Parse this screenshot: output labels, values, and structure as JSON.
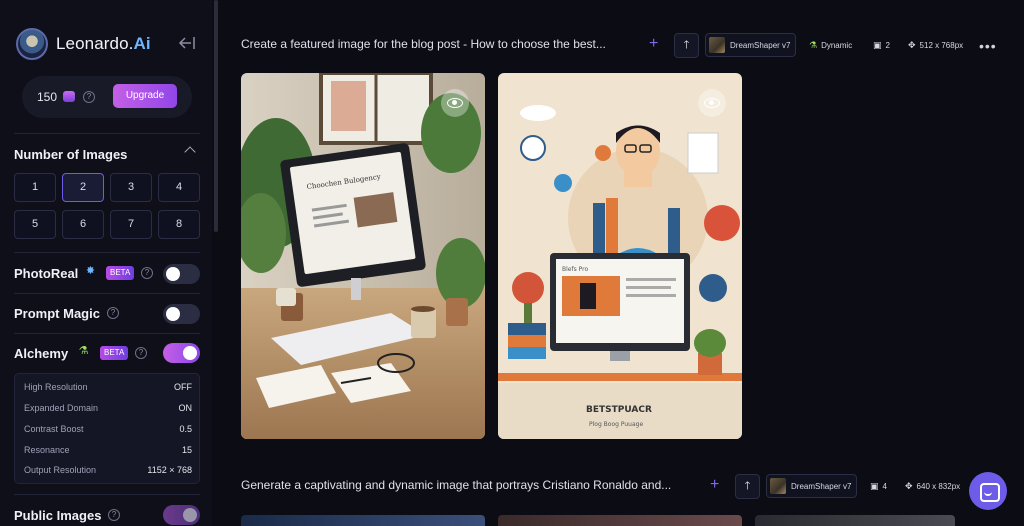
{
  "brand": {
    "name_prefix": "Leonardo.",
    "name_suffix": "Ai"
  },
  "tokens": {
    "count": "150",
    "help": "?",
    "upgrade_label": "Upgrade"
  },
  "number_of_images": {
    "title": "Number of Images",
    "options": [
      "1",
      "2",
      "3",
      "4",
      "5",
      "6",
      "7",
      "8"
    ],
    "selected": "2"
  },
  "photoreal": {
    "label": "PhotoReal",
    "badge": "BETA",
    "enabled": false
  },
  "prompt_magic": {
    "label": "Prompt Magic",
    "enabled": false
  },
  "alchemy": {
    "label": "Alchemy",
    "badge": "BETA",
    "enabled": true,
    "settings": [
      {
        "label": "High Resolution",
        "value": "OFF"
      },
      {
        "label": "Expanded Domain",
        "value": "ON"
      },
      {
        "label": "Contrast Boost",
        "value": "0.5"
      },
      {
        "label": "Resonance",
        "value": "15"
      },
      {
        "label": "Output Resolution",
        "value": "1152 × 768"
      }
    ]
  },
  "public_images": {
    "label": "Public Images",
    "enabled": true
  },
  "generations": [
    {
      "prompt": "Create a featured image for the blog post - How to choose the best...",
      "model": "DreamShaper v7",
      "style": "Dynamic",
      "count": "2",
      "size": "512 x 768px",
      "images": [
        {
          "screen_title": "Choochen Bulogency"
        },
        {
          "caption_title": "BETSTPUACR",
          "caption_sub": "Plog Boog Puuage",
          "screen_label": "Blefs Pro"
        }
      ]
    },
    {
      "prompt": "Generate a captivating and dynamic image that portrays Cristiano Ronaldo and...",
      "model": "DreamShaper v7",
      "count": "4",
      "size": "640 x 832px"
    }
  ],
  "colors": {
    "accent": "#6c5ce7",
    "bg": "#0b0c14",
    "upgrade_gradient": "#c45fe6"
  }
}
